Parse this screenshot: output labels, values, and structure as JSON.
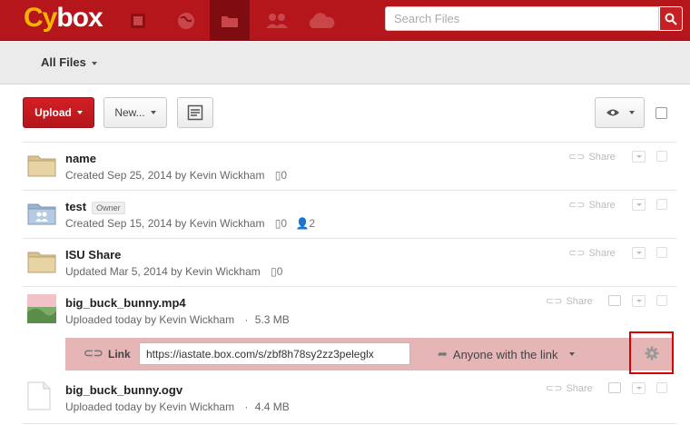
{
  "app": {
    "logo_part1": "Cy",
    "logo_part2": "box"
  },
  "search": {
    "placeholder": "Search Files"
  },
  "subheader": {
    "all_files_label": "All Files"
  },
  "toolbar": {
    "upload_label": "Upload",
    "new_label": "New..."
  },
  "items": [
    {
      "name": "name",
      "meta": "Created Sep 25, 2014 by Kevin Wickham",
      "files": "0",
      "share": "Share"
    },
    {
      "name": "test",
      "badge": "Owner",
      "meta": "Created Sep 15, 2014 by Kevin Wickham",
      "files": "0",
      "collaborators": "2",
      "share": "Share"
    },
    {
      "name": "ISU Share",
      "meta": "Updated Mar 5, 2014 by Kevin Wickham",
      "files": "0",
      "share": "Share"
    },
    {
      "name": "big_buck_bunny.mp4",
      "meta": "Uploaded today by Kevin Wickham",
      "size": "5.3 MB",
      "share": "Share"
    },
    {
      "name": "big_buck_bunny.ogv",
      "meta": "Uploaded today by Kevin Wickham",
      "size": "4.4 MB",
      "share": "Share"
    }
  ],
  "share_link": {
    "label": "Link",
    "url": "https://iastate.box.com/s/zbf8h78sy2zz3peleglx",
    "access": "Anyone with the link"
  },
  "colors": {
    "brand_red": "#b5161c",
    "accent_yellow": "#f7b400",
    "link_bar": "#e6b5b6",
    "highlight_box": "#dd0000"
  }
}
